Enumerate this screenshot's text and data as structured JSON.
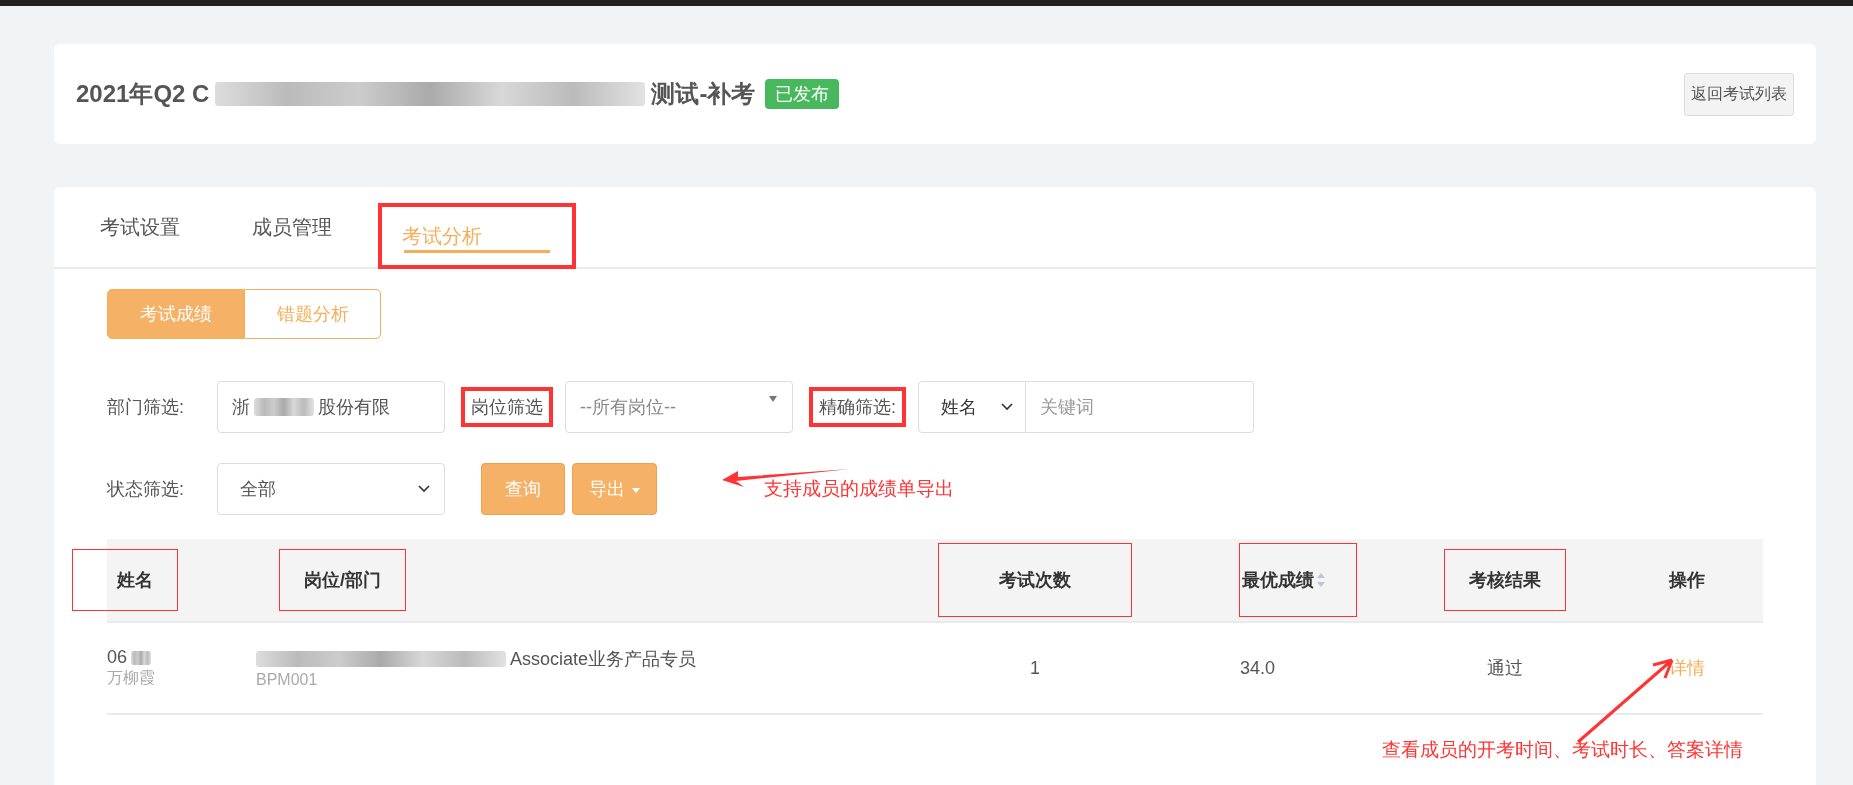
{
  "header": {
    "title_start": "2021年Q2 C",
    "title_end": "测试-补考",
    "status": "已发布",
    "back_button": "返回考试列表"
  },
  "tabs": [
    {
      "label": "考试设置",
      "selected": false,
      "highlighted": false
    },
    {
      "label": "成员管理",
      "selected": false,
      "highlighted": false
    },
    {
      "label": "考试分析",
      "selected": true,
      "highlighted": true
    }
  ],
  "subtabs": [
    {
      "label": "考试成绩",
      "selected": true
    },
    {
      "label": "错题分析",
      "selected": false
    }
  ],
  "filters": {
    "department": {
      "label": "部门筛选:",
      "value_start": "浙",
      "value_end": "股份有限",
      "highlighted": false
    },
    "position": {
      "label": "岗位筛选",
      "value": "--所有岗位--",
      "highlighted": true
    },
    "exact": {
      "label": "精确筛选:",
      "field": "姓名",
      "placeholder": "关键词",
      "highlighted": true
    },
    "status": {
      "label": "状态筛选:",
      "value": "全部",
      "highlighted": false
    },
    "query_button": "查询",
    "export_button": "导出"
  },
  "table": {
    "columns": [
      {
        "label": "姓名",
        "highlighted": true,
        "sortable": false
      },
      {
        "label": "岗位/部门",
        "highlighted": true,
        "sortable": false
      },
      {
        "label": "考试次数",
        "highlighted": true,
        "sortable": false
      },
      {
        "label": "最优成绩",
        "highlighted": true,
        "sortable": true
      },
      {
        "label": "考核结果",
        "highlighted": true,
        "sortable": false
      },
      {
        "label": "操作",
        "highlighted": false,
        "sortable": false
      }
    ],
    "rows": [
      {
        "id": "06",
        "name": "万柳霞",
        "position": "Associate业务产品专员",
        "code": "BPM001",
        "attempts": "1",
        "best": "34.0",
        "result": "通过",
        "action": "详情"
      }
    ]
  },
  "annotations": [
    {
      "text": "支持成员的成绩单导出"
    },
    {
      "text": "查看成员的开考时间、考试时长、答案详情"
    }
  ]
}
